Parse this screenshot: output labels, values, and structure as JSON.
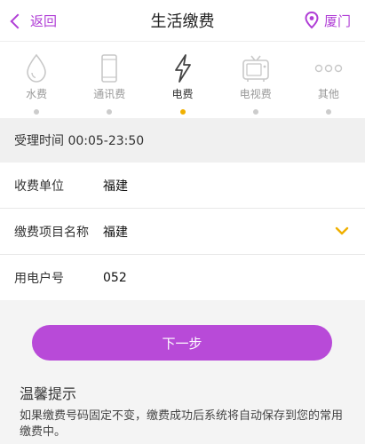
{
  "nav": {
    "back_label": "返回",
    "title": "生活缴费",
    "city": "厦门"
  },
  "colors": {
    "accent": "#b84ad8",
    "active_dot": "#f0b000"
  },
  "tabs": [
    {
      "label": "水费",
      "icon": "water-drop-icon",
      "active": false
    },
    {
      "label": "通讯费",
      "icon": "phone-icon",
      "active": false
    },
    {
      "label": "电费",
      "icon": "lightning-icon",
      "active": true
    },
    {
      "label": "电视费",
      "icon": "tv-icon",
      "active": false
    },
    {
      "label": "其他",
      "icon": "more-dots-icon",
      "active": false
    }
  ],
  "service_hours": "受理时间 00:05-23:50",
  "form": {
    "payee_label": "收费单位",
    "payee_value": "福建",
    "item_label": "缴费项目名称",
    "item_value": "福建",
    "account_label": "用电户号",
    "account_value": "052"
  },
  "next_label": "下一步",
  "tips": {
    "title": "温馨提示",
    "body": "如果缴费号码固定不变，缴费成功后系统将自动保存到您的常用缴费中。"
  }
}
